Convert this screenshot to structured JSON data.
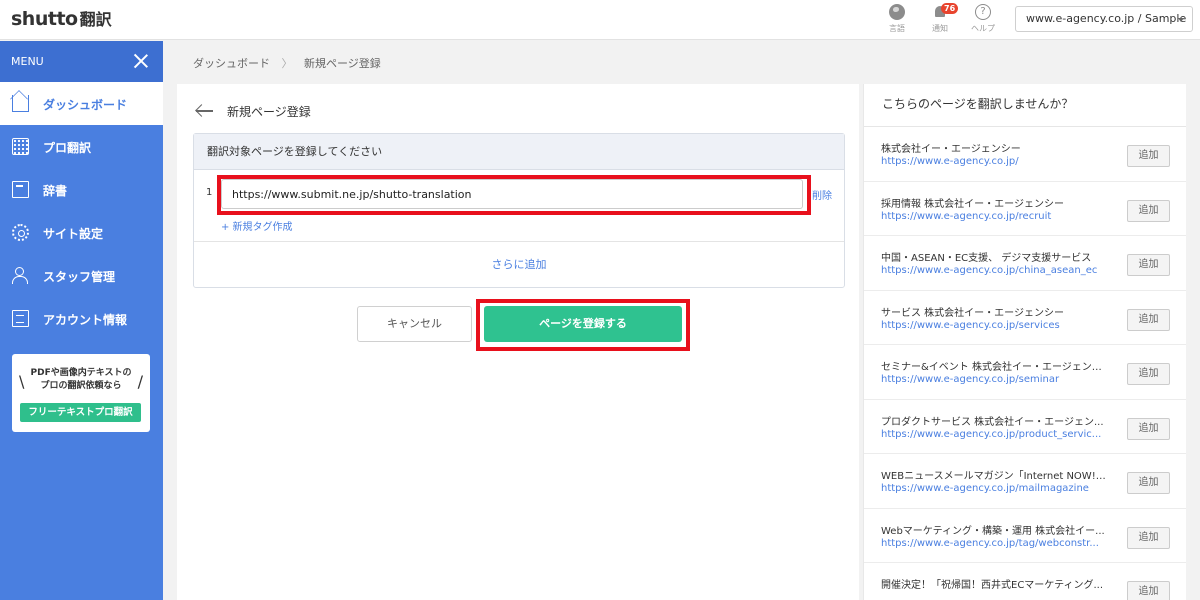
{
  "header": {
    "logo": "shutto",
    "logo_sub": "翻訳",
    "icons": [
      {
        "name": "globe-icon",
        "label": "言語"
      },
      {
        "name": "bell-icon",
        "label": "通知",
        "badge": "76"
      },
      {
        "name": "help-icon",
        "label": "ヘルプ",
        "glyph": "?"
      }
    ],
    "site_selector": "www.e-agency.co.jp / Sample"
  },
  "sidebar": {
    "menu_label": "MENU",
    "items": [
      {
        "label": "ダッシュボード",
        "icon": "house-icon",
        "active": true
      },
      {
        "label": "プロ翻訳",
        "icon": "grid-icon"
      },
      {
        "label": "辞書",
        "icon": "book-icon"
      },
      {
        "label": "サイト設定",
        "icon": "gear-icon"
      },
      {
        "label": "スタッフ管理",
        "icon": "users-icon"
      },
      {
        "label": "アカウント情報",
        "icon": "document-icon"
      }
    ],
    "promo": {
      "line1": "PDFや画像内テキストの",
      "line2": "プロの翻訳依頼なら",
      "button": "フリーテキストプロ翻訳"
    }
  },
  "breadcrumb": {
    "items": [
      "ダッシュボード",
      "新規ページ登録"
    ],
    "separator": "〉"
  },
  "main": {
    "title": "新規ページ登録",
    "panel_title": "翻訳対象ページを登録してください",
    "row_number": "1",
    "url_value": "https://www.submit.ne.jp/shutto-translation",
    "delete_label": "削除",
    "new_tag_label": "+ 新規タグ作成",
    "add_more_label": "さらに追加",
    "cancel_label": "キャンセル",
    "submit_label": "ページを登録する"
  },
  "suggestions": {
    "title": "こちらのページを翻訳しませんか？",
    "add_label": "追加",
    "items": [
      {
        "name": "株式会社イー・エージェンシー",
        "url": "https://www.e-agency.co.jp/"
      },
      {
        "name": "採用情報 株式会社イー・エージェンシー",
        "url": "https://www.e-agency.co.jp/recruit"
      },
      {
        "name": "中国・ASEAN・EC支援、 デジマ支援サービス",
        "url": "https://www.e-agency.co.jp/china_asean_ec"
      },
      {
        "name": "サービス 株式会社イー・エージェンシー",
        "url": "https://www.e-agency.co.jp/services"
      },
      {
        "name": "セミナー&イベント 株式会社イー・エージェンシ...",
        "url": "https://www.e-agency.co.jp/seminar"
      },
      {
        "name": "プロダクトサービス 株式会社イー・エージェン...",
        "url": "https://www.e-agency.co.jp/product_servic..."
      },
      {
        "name": "WEBニュースメールマガジン「Internet NOW!+...",
        "url": "https://www.e-agency.co.jp/mailmagazine"
      },
      {
        "name": "Webマーケティング・構築・運用 株式会社イー...",
        "url": "https://www.e-agency.co.jp/tag/webconstr..."
      },
      {
        "name": "開催決定！「祝帰国！西井式ECマーケティング...",
        "url": ""
      }
    ]
  },
  "colors": {
    "sidebar": "#4a7fe0",
    "accent_green": "#2fc290",
    "highlight_red": "#e8101c",
    "link_blue": "#4a7fe0"
  }
}
